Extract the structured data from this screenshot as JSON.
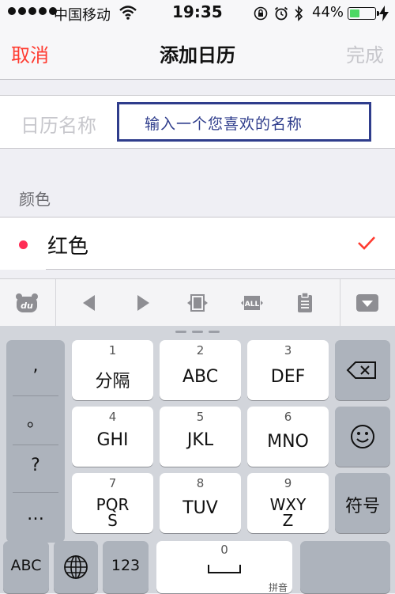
{
  "status_bar": {
    "carrier": "中国移动",
    "time": "19:35",
    "battery_percent": "44%",
    "battery_level": 0.44
  },
  "nav": {
    "cancel": "取消",
    "title": "添加日历",
    "done": "完成"
  },
  "form": {
    "name_label": "日历名称",
    "name_hint": "输入一个您喜欢的名称",
    "color_header": "颜色",
    "color_selected": "红色",
    "color_value": "#ff2d55"
  },
  "keyboard": {
    "punct": [
      ",",
      "。",
      "?",
      "…"
    ],
    "keys": [
      {
        "num": "1",
        "label": "分隔"
      },
      {
        "num": "2",
        "label": "ABC"
      },
      {
        "num": "3",
        "label": "DEF"
      },
      {
        "num": "4",
        "label": "GHI"
      },
      {
        "num": "5",
        "label": "JKL"
      },
      {
        "num": "6",
        "label": "MNO"
      },
      {
        "num": "7",
        "label": "PQR\nS"
      },
      {
        "num": "8",
        "label": "TUV"
      },
      {
        "num": "9",
        "label": "WXY\nZ"
      }
    ],
    "symbols": "符号",
    "abc": "ABC",
    "num_switch": "123",
    "space_num": "0",
    "input_mode": "拼音"
  },
  "colors": {
    "accent_red": "#ff3b30",
    "hint_blue": "#2f3d8c",
    "battery_green": "#4cd964"
  }
}
